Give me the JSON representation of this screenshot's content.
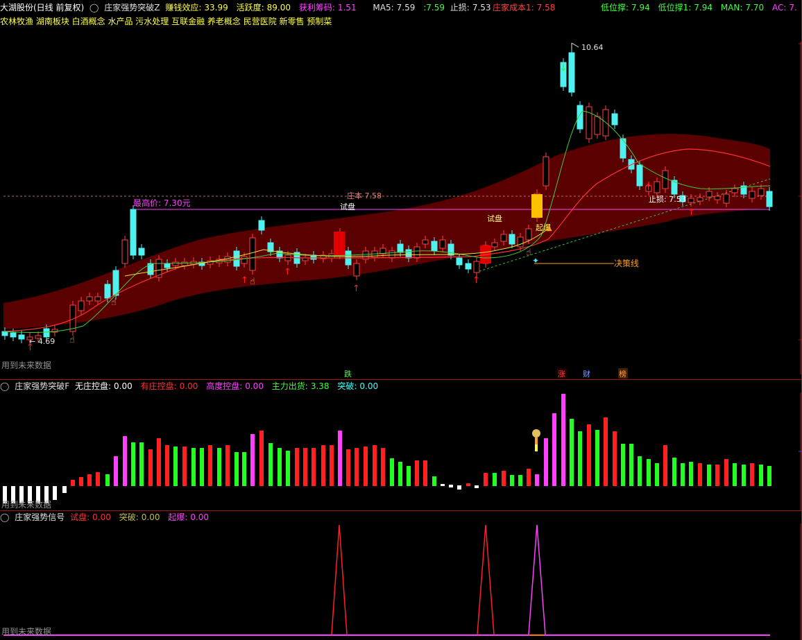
{
  "title_bar": {
    "stock": "大湖股份(日线 前复权)",
    "indicator": "庄家强势突破Z",
    "earn_label": "赚钱效应:",
    "earn_value": "33.99",
    "active_label": "活跃度:",
    "active_value": "89.00",
    "profit_label": "获利筹码:",
    "profit_value": "1.51",
    "ma5_label": "MA5:",
    "ma5_value": "7.59",
    "ma_extra": ":7.59",
    "stop_label": "止损:",
    "stop_value": "7.53",
    "cost_label": "庄家成本1:",
    "cost_value": "7.58",
    "low1_label": "低位撑:",
    "low1_value": "7.94",
    "low2_label": "低位撑1:",
    "low2_value": "7.94",
    "man_label": "MAN:",
    "man_value": "7.70",
    "ac_label": "AC:",
    "ac_value": "7."
  },
  "concepts": "农林牧渔 湖南板块 白酒概念 水产品 污水处理 互联金融 养老概念 民营医院 新零售 预制菜",
  "main_chart": {
    "high_label": "10.64",
    "low_label": "← 4.69",
    "max_price_label": "最高价: 7.30元",
    "zhuang_cost_label": "庄本 7.58",
    "trial_label_1": "试盘",
    "trial_label_2": "试盘",
    "decision_label": "决策线",
    "stop_label": "止损: 7.53",
    "explode_label": "起爆",
    "future_data": "用到未来数据",
    "markers": [
      "跌",
      "涨",
      "财",
      "榜"
    ],
    "colors": {
      "up": "#ff4040",
      "down": "#4ff0f0",
      "band": "#5a0000"
    }
  },
  "panel2": {
    "name": "庄家强势突破F",
    "items": [
      {
        "label": "无庄控盘:",
        "value": "0.00",
        "color": "#ffffff"
      },
      {
        "label": "有庄控盘:",
        "value": "0.00",
        "color": "#ff3030"
      },
      {
        "label": "高度控盘:",
        "value": "0.00",
        "color": "#ff40ff"
      },
      {
        "label": "主力出货:",
        "value": "3.38",
        "color": "#40ff40"
      },
      {
        "label": "突破:",
        "value": "0.00",
        "color": "#40ffff"
      }
    ],
    "future_data": "用到未来数据"
  },
  "panel3": {
    "name": "庄家强势信号",
    "items": [
      {
        "label": "试盘:",
        "value": "0.00",
        "color": "#ff3030"
      },
      {
        "label": "突破:",
        "value": "0.00",
        "color": "#c0c040"
      },
      {
        "label": "起爆:",
        "value": "0.00",
        "color": "#ff40ff"
      }
    ],
    "future_data": "用到未来数据"
  }
}
